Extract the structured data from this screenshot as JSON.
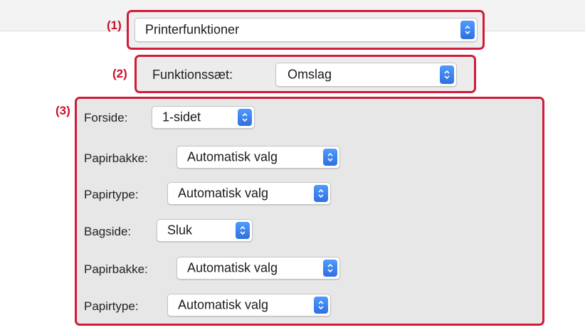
{
  "callouts": {
    "c1": "(1)",
    "c2": "(2)",
    "c3": "(3)"
  },
  "main_popup": {
    "value": "Printerfunktioner"
  },
  "feature_set": {
    "label": "Funktionssæt:",
    "value": "Omslag"
  },
  "rows": [
    {
      "label": "Forside:",
      "value": "1-sidet"
    },
    {
      "label": "Papirbakke:",
      "value": "Automatisk valg"
    },
    {
      "label": "Papirtype:",
      "value": "Automatisk valg"
    },
    {
      "label": "Bagside:",
      "value": "Sluk"
    },
    {
      "label": "Papirbakke:",
      "value": "Automatisk valg"
    },
    {
      "label": "Papirtype:",
      "value": "Automatisk valg"
    }
  ],
  "colors": {
    "highlight": "#d11b3a",
    "stepper": "#2f6fe0"
  },
  "icons": {
    "popup_arrow": "chevron-up-down-icon"
  }
}
